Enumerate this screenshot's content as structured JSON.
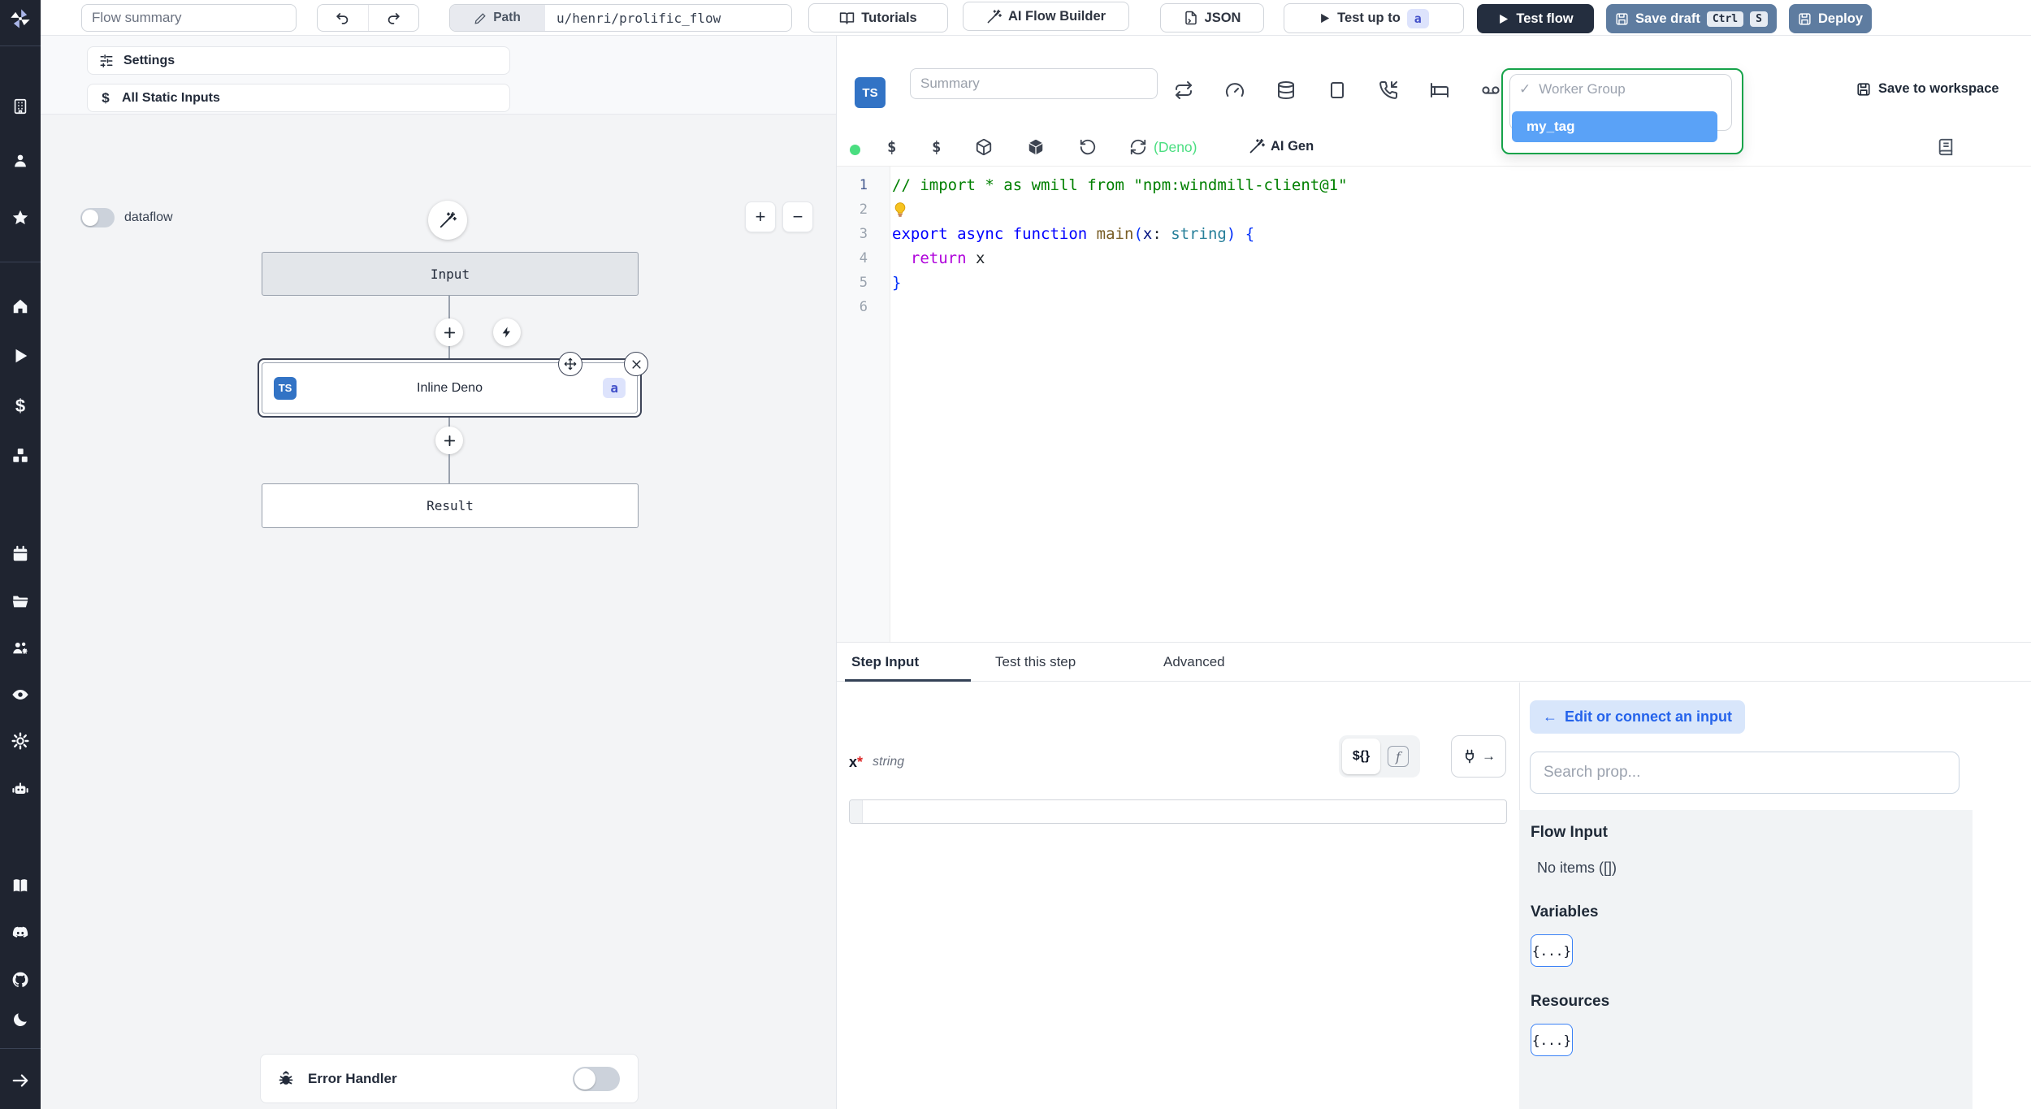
{
  "colors": {
    "sidebar_bg": "#1f2430",
    "dark_button_bg": "#242e3f",
    "slate_button_bg": "#5e7ca0",
    "badge_bg": "#dde3fc",
    "badge_text": "#4250c9",
    "ts_badge_bg": "#3273c5",
    "dropdown_border": "#16a34a",
    "selected_tag_bg": "#5aa2f7",
    "deno_green": "#4ade80",
    "accent_blue": "#2563eb"
  },
  "sidebar": {
    "icons": [
      "windmill-logo",
      "workspace",
      "user",
      "favorites",
      "home",
      "runs",
      "variables",
      "resources",
      "schedules",
      "folders",
      "groups",
      "audit-logs",
      "settings",
      "workers",
      "docs",
      "discord",
      "github",
      "dark-mode",
      "expand-sidebar"
    ]
  },
  "topbar": {
    "flow_summary_placeholder": "Flow summary",
    "path_label": "Path",
    "path_value": "u/henri/prolific_flow",
    "tutorials_label": "Tutorials",
    "ai_flow_builder_label": "AI Flow Builder",
    "json_label": "JSON",
    "test_up_to_label": "Test up to",
    "test_up_to_badge": "a",
    "test_flow_label": "Test flow",
    "save_draft_label": "Save draft",
    "kbd_ctrl": "Ctrl",
    "kbd_s": "S",
    "deploy_label": "Deploy"
  },
  "flow": {
    "settings_label": "Settings",
    "static_inputs_icon": "$",
    "all_static_inputs_label": "All Static Inputs",
    "dataflow_label": "dataflow",
    "zoom_in": "+",
    "zoom_out": "−",
    "input_node": "Input",
    "step_node": {
      "lang_badge": "TS",
      "title": "Inline Deno",
      "id_badge": "a"
    },
    "result_node": "Result",
    "error_handler_label": "Error Handler"
  },
  "editor": {
    "lang_badge": "TS",
    "summary_placeholder": "Summary",
    "worker_group_dropdown": {
      "check": "✓",
      "label": "Worker Group",
      "selected_tag": "my_tag"
    },
    "save_to_workspace_label": "Save to workspace",
    "dollar_icon": "$",
    "deno_label": "(Deno)",
    "ai_gen_label": "AI Gen",
    "code": {
      "lines": [
        {
          "n": "1",
          "seg": [
            [
              "comment",
              "// import * as wmill from \"npm:windmill-client@1\""
            ]
          ]
        },
        {
          "n": "2",
          "bulb": true,
          "seg": []
        },
        {
          "n": "3",
          "seg": [
            [
              "kw",
              "export async function "
            ],
            [
              "fn",
              "main"
            ],
            [
              "br",
              "("
            ],
            [
              "var",
              "x"
            ],
            [
              "plain",
              ": "
            ],
            [
              "type",
              "string"
            ],
            [
              "br",
              ")"
            ],
            [
              "plain",
              " "
            ],
            [
              "br",
              "{"
            ]
          ]
        },
        {
          "n": "4",
          "seg": [
            [
              "plain",
              "  "
            ],
            [
              "ret",
              "return"
            ],
            [
              "plain",
              " x"
            ]
          ]
        },
        {
          "n": "5",
          "seg": [
            [
              "br",
              "}"
            ]
          ]
        },
        {
          "n": "6",
          "seg": []
        }
      ]
    }
  },
  "bottom": {
    "tabs": [
      {
        "label": "Step Input"
      },
      {
        "label": "Test this step"
      },
      {
        "label": "Advanced"
      }
    ],
    "field": {
      "name": "x",
      "required": "*",
      "type": "string",
      "expr_btn": "${}",
      "fn_btn": "f"
    },
    "props": {
      "back_arrow": "←",
      "edit_or_connect_label": "Edit or connect an input",
      "search_placeholder": "Search prop...",
      "flow_input_title": "Flow Input",
      "flow_input_empty": "No items ([])",
      "variables_title": "Variables",
      "variables_value": "{...}",
      "resources_title": "Resources",
      "resources_value": "{...}"
    }
  }
}
